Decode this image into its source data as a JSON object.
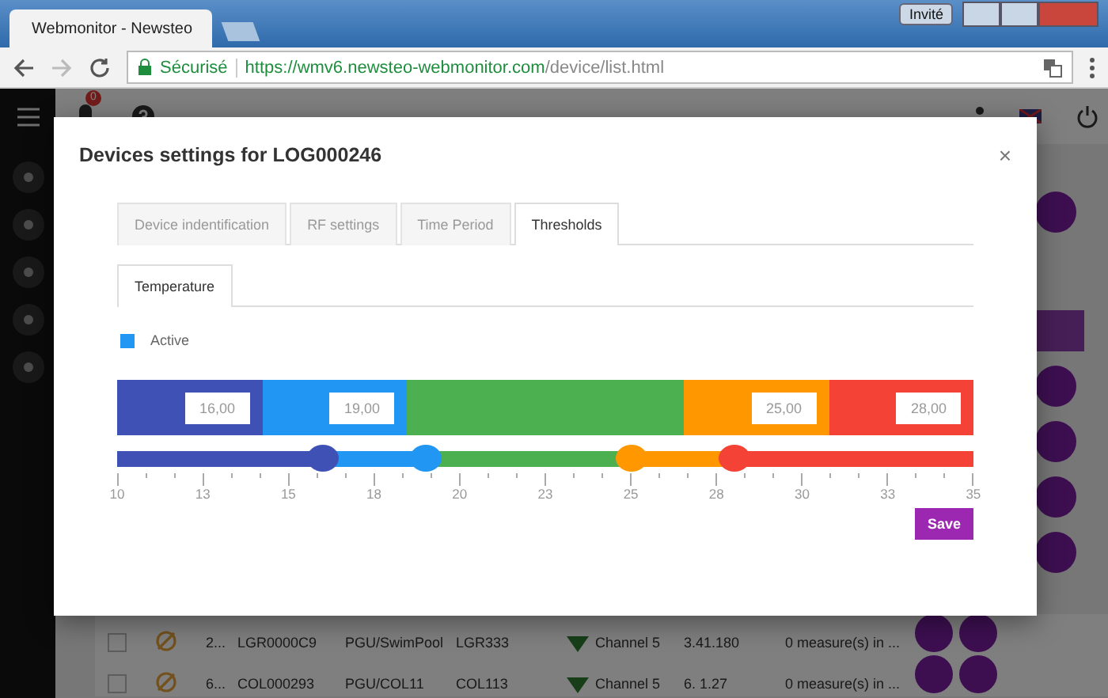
{
  "browser": {
    "tab_title": "Webmonitor - Newsteo",
    "guest_button": "Invité",
    "secure_label": "Sécurisé",
    "url_host": "https://wmv6.newsteo-webmonitor.com",
    "url_path": "/device/list.html"
  },
  "topbar": {
    "notification_count": "0"
  },
  "modal": {
    "title": "Devices settings for LOG000246",
    "close": "×",
    "tabs": [
      {
        "label": "Device indentification",
        "selected": false
      },
      {
        "label": "RF settings",
        "selected": false
      },
      {
        "label": "Time Period",
        "selected": false
      },
      {
        "label": "Thresholds",
        "selected": true
      }
    ],
    "subtabs": [
      {
        "label": "Temperature",
        "selected": true
      }
    ],
    "active": {
      "label": "Active",
      "checked": true
    },
    "zones": [
      {
        "color": "#3f51b5",
        "value": "16,00"
      },
      {
        "color": "#2196f3",
        "value": "19,00"
      },
      {
        "color": "#4caf50"
      },
      {
        "color": "#ff9800",
        "value": "25,00"
      },
      {
        "color": "#f44336",
        "value": "28,00"
      }
    ],
    "thumbs": [
      {
        "color": "#3f51b5",
        "level": 0.24
      },
      {
        "color": "#2196f3",
        "level": 0.36
      },
      {
        "color": "#ff9800",
        "level": 0.6
      },
      {
        "color": "#f44336",
        "level": 0.72
      }
    ],
    "scale": [
      "10",
      "13",
      "15",
      "18",
      "20",
      "23",
      "25",
      "28",
      "30",
      "33",
      "35"
    ],
    "save": "Save"
  },
  "rows": [
    {
      "checked": false,
      "index": "2...",
      "id": "LGR0000C9",
      "group": "PGU/SwimPool",
      "name": "LGR333",
      "channel": "Channel 5",
      "version": "3.41.180",
      "measures": "0 measure(s) in ..."
    },
    {
      "checked": false,
      "index": "6...",
      "id": "COL000293",
      "group": "PGU/COL11",
      "name": "COL113",
      "channel": "Channel 5",
      "version": "6. 1.27",
      "measures": "0 measure(s) in ..."
    }
  ]
}
